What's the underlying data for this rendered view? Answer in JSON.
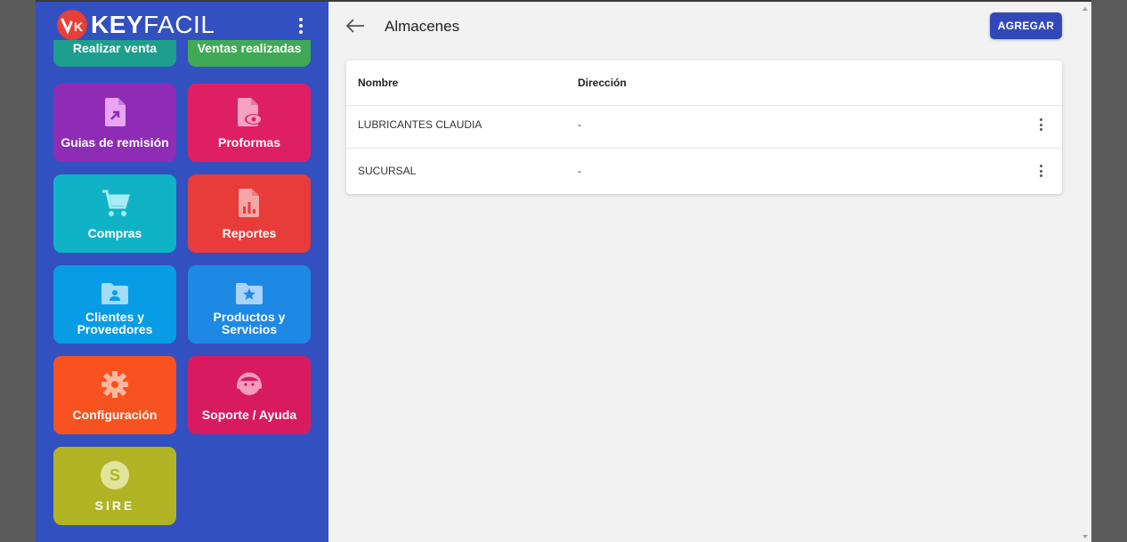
{
  "brand": {
    "mark": "K",
    "name_bold": "KEY",
    "name_light": "FACIL"
  },
  "colors": {
    "sidebar": "#3350c0",
    "accent": "#3348b8"
  },
  "tiles": [
    {
      "label": "Realizar venta",
      "color": "#1e9e8c",
      "icon": "cart-icon"
    },
    {
      "label": "Ventas realizadas",
      "color": "#3fa955",
      "icon": "receipt-icon"
    },
    {
      "label": "Guias de remisión",
      "color": "#8e2cb6",
      "icon": "document-arrow-icon"
    },
    {
      "label": "Proformas",
      "color": "#df1f63",
      "icon": "document-eye-icon"
    },
    {
      "label": "Compras",
      "color": "#10b3c6",
      "icon": "shopping-cart-icon"
    },
    {
      "label": "Reportes",
      "color": "#e83c3b",
      "icon": "report-chart-icon"
    },
    {
      "label": "Clientes y Proveedores",
      "color": "#079ce6",
      "icon": "folder-person-icon"
    },
    {
      "label": "Productos y Servicios",
      "color": "#1e88e5",
      "icon": "folder-star-icon"
    },
    {
      "label": "Configuración",
      "color": "#f7521f",
      "icon": "gear-icon"
    },
    {
      "label": "Soporte / Ayuda",
      "color": "#d81b60",
      "icon": "support-agent-icon"
    },
    {
      "label": "SIRE",
      "color": "#b0b424",
      "icon": "sire-coin-icon"
    }
  ],
  "header": {
    "title": "Almacenes",
    "add_label": "AGREGAR"
  },
  "table": {
    "columns": [
      "Nombre",
      "Dirección"
    ],
    "rows": [
      {
        "nombre": "LUBRICANTES CLAUDIA",
        "direccion": "-"
      },
      {
        "nombre": "SUCURSAL",
        "direccion": "-"
      }
    ]
  }
}
